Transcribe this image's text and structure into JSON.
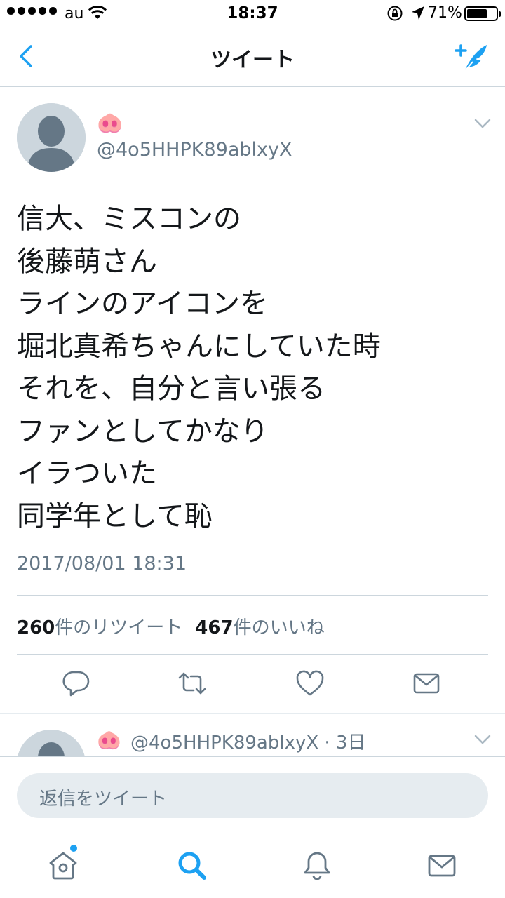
{
  "status_bar": {
    "carrier": "au",
    "time": "18:37",
    "battery_percent": "71%",
    "battery_level": 0.71
  },
  "nav": {
    "title": "ツイート",
    "back_icon": "chevron-left-icon",
    "compose_icon": "compose-tweet-icon"
  },
  "tweet": {
    "display_name": "🐽",
    "handle": "@4o5HHPK89ablxyX",
    "text_lines": [
      "信大、ミスコンの",
      "後藤萌さん",
      "ラインのアイコンを",
      "堀北真希ちゃんにしていた時",
      "それを、自分と言い張る",
      "ファンとしてかなり",
      "イラついた",
      "同学年として恥"
    ],
    "timestamp": "2017/08/01 18:31",
    "retweet_count": "260",
    "retweet_label": "件のリツイート",
    "like_count": "467",
    "like_label": "件のいいね"
  },
  "reply": {
    "display_name": "🐽",
    "handle": "@4o5HHPK89ablxyX",
    "meta": "· 3日"
  },
  "compose": {
    "placeholder": "返信をツイート"
  },
  "tabs": [
    {
      "icon": "home-icon",
      "active": false,
      "has_badge": true
    },
    {
      "icon": "search-icon",
      "active": true
    },
    {
      "icon": "notifications-bell-icon",
      "active": false
    },
    {
      "icon": "messages-envelope-icon",
      "active": false
    }
  ],
  "colors": {
    "accent": "#1da1f2",
    "secondary_text": "#657786",
    "icon_gray": "#657786",
    "divider": "#ccd6dd"
  }
}
